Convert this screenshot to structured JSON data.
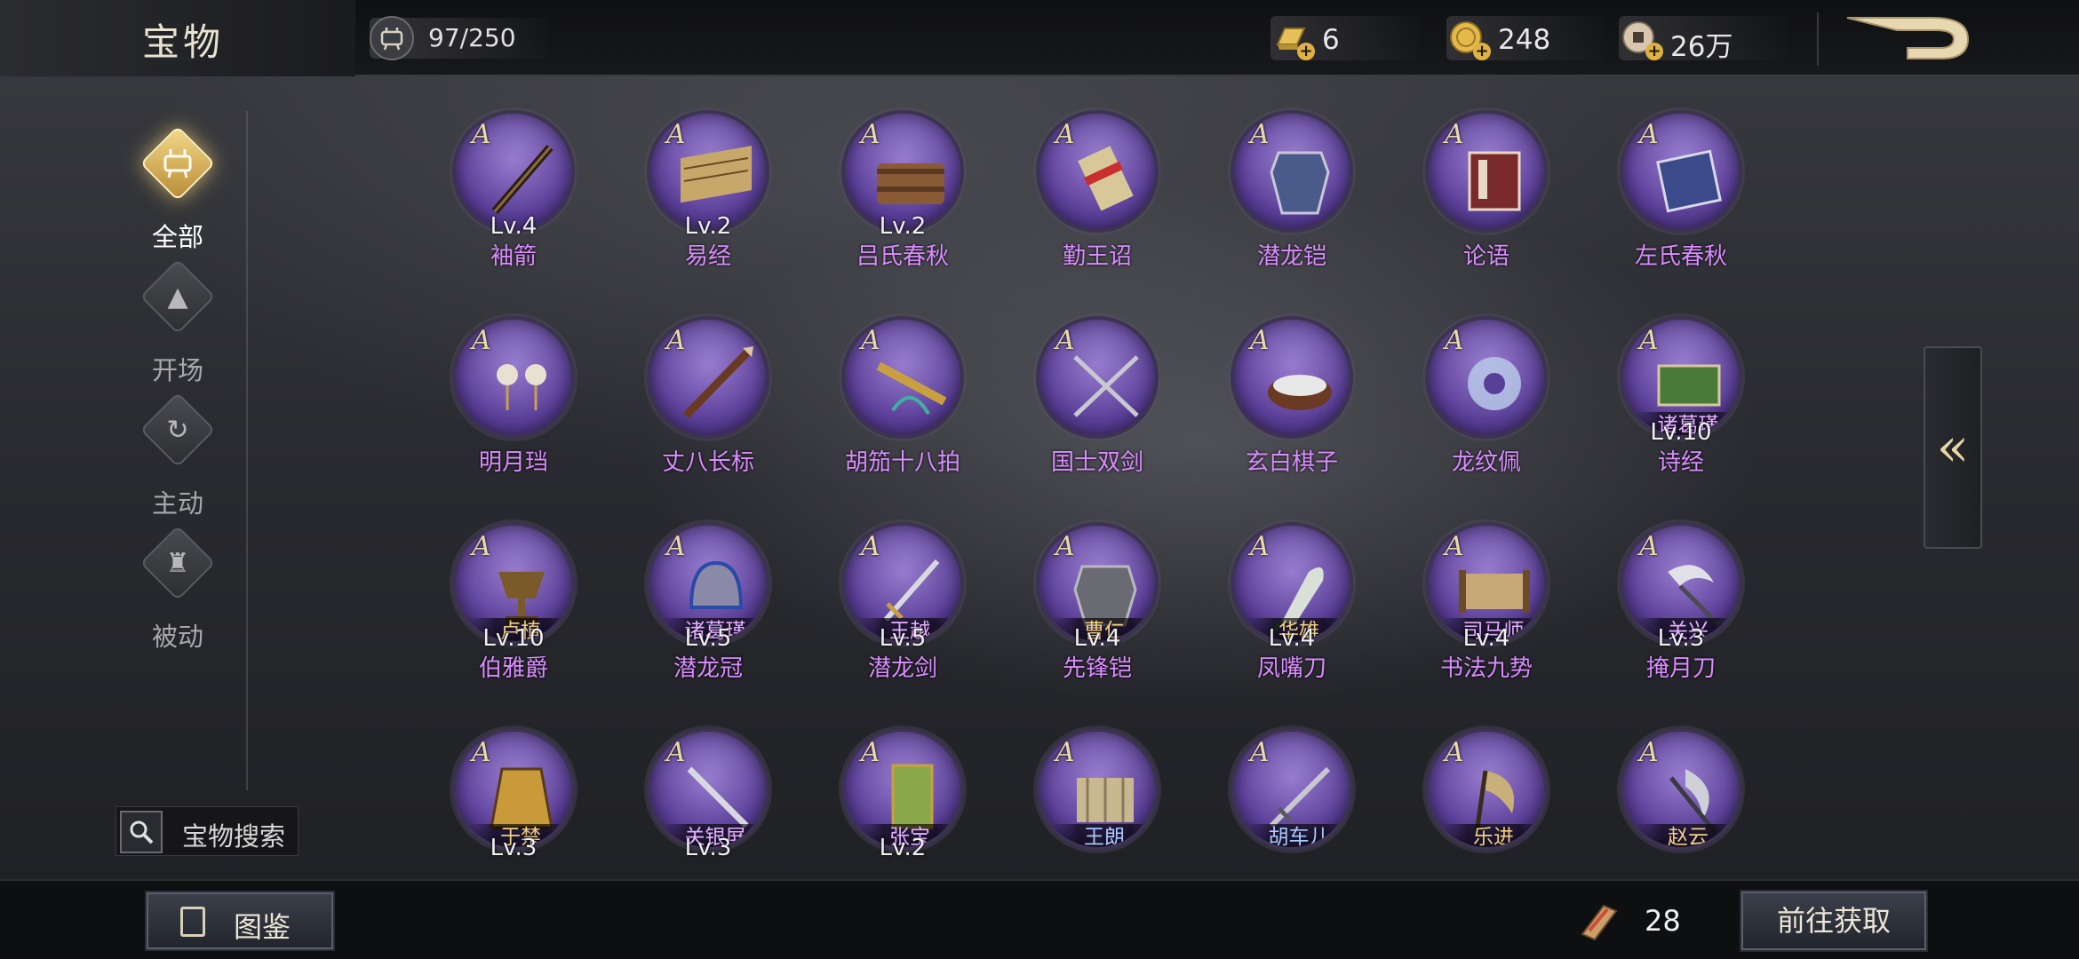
{
  "header": {
    "title": "宝物",
    "capacity": "97/250",
    "currencies": [
      {
        "name": "gold-bar-icon",
        "value": "6"
      },
      {
        "name": "coin-icon",
        "value": "248"
      },
      {
        "name": "copper-coin-icon",
        "value": "26万"
      }
    ]
  },
  "sidebar": {
    "items": [
      {
        "label": "全部",
        "icon": "cauldron-icon",
        "active": true
      },
      {
        "label": "开场",
        "icon": "pyramid-icon",
        "active": false
      },
      {
        "label": "主动",
        "icon": "swirl-icon",
        "active": false
      },
      {
        "label": "被动",
        "icon": "armor-icon",
        "active": false
      }
    ],
    "search_label": "宝物搜索"
  },
  "items": [
    {
      "grade": "A",
      "tag": "",
      "lv": "Lv.4",
      "name": "袖箭",
      "art": "staff"
    },
    {
      "grade": "A",
      "tag": "",
      "lv": "Lv.2",
      "name": "易经",
      "art": "scroll"
    },
    {
      "grade": "A",
      "tag": "",
      "lv": "Lv.2",
      "name": "吕氏春秋",
      "art": "bamboo"
    },
    {
      "grade": "A",
      "tag": "",
      "lv": "",
      "name": "勤王诏",
      "art": "redscroll"
    },
    {
      "grade": "A",
      "tag": "",
      "lv": "",
      "name": "潜龙铠",
      "art": "armor"
    },
    {
      "grade": "A",
      "tag": "",
      "lv": "",
      "name": "论语",
      "art": "book"
    },
    {
      "grade": "A",
      "tag": "",
      "lv": "",
      "name": "左氏春秋",
      "art": "bluebook"
    },
    {
      "grade": "A",
      "tag": "",
      "lv": "",
      "name": "明月珰",
      "art": "earrings"
    },
    {
      "grade": "A",
      "tag": "",
      "lv": "",
      "name": "丈八长标",
      "art": "spear"
    },
    {
      "grade": "A",
      "tag": "",
      "lv": "",
      "name": "胡笳十八拍",
      "art": "flute"
    },
    {
      "grade": "A",
      "tag": "",
      "lv": "",
      "name": "国士双剑",
      "art": "swords"
    },
    {
      "grade": "A",
      "tag": "",
      "lv": "",
      "name": "玄白棋子",
      "art": "go"
    },
    {
      "grade": "A",
      "tag": "",
      "lv": "",
      "name": "龙纹佩",
      "art": "jade"
    },
    {
      "grade": "A",
      "tag": "诸葛瑾",
      "tagc": "purple",
      "lv": "Lv.10",
      "name": "诗经",
      "art": "greenbook"
    },
    {
      "grade": "A",
      "tag": "卢植",
      "tagc": "gold",
      "lv": "Lv.10",
      "name": "伯雅爵",
      "art": "cup"
    },
    {
      "grade": "A",
      "tag": "诸葛瑾",
      "tagc": "purple",
      "lv": "Lv.5",
      "name": "潜龙冠",
      "art": "helmet"
    },
    {
      "grade": "A",
      "tag": "王越",
      "tagc": "purple",
      "lv": "Lv.5",
      "name": "潜龙剑",
      "art": "sword"
    },
    {
      "grade": "A",
      "tag": "曹仁",
      "tagc": "gold",
      "lv": "Lv.4",
      "name": "先锋铠",
      "art": "armor2"
    },
    {
      "grade": "A",
      "tag": "华雄",
      "tagc": "gold",
      "lv": "Lv.4",
      "name": "凤嘴刀",
      "art": "blade"
    },
    {
      "grade": "A",
      "tag": "司马师",
      "tagc": "purple",
      "lv": "Lv.4",
      "name": "书法九势",
      "art": "scroll2"
    },
    {
      "grade": "A",
      "tag": "关兴",
      "tagc": "purple",
      "lv": "Lv.3",
      "name": "掩月刀",
      "art": "moonblade"
    },
    {
      "grade": "A",
      "tag": "于禁",
      "tagc": "gold",
      "lv": "Lv.3",
      "name": "",
      "art": "robe"
    },
    {
      "grade": "A",
      "tag": "关银屏",
      "tagc": "purple",
      "lv": "Lv.3",
      "name": "",
      "art": "sword2"
    },
    {
      "grade": "A",
      "tag": "张宝",
      "tagc": "purple",
      "lv": "Lv.2",
      "name": "",
      "art": "banner"
    },
    {
      "grade": "A",
      "tag": "王朗",
      "tagc": "blue",
      "lv": "",
      "name": "",
      "art": "bamboo2"
    },
    {
      "grade": "A",
      "tag": "胡车儿",
      "tagc": "blue",
      "lv": "",
      "name": "",
      "art": "sword3"
    },
    {
      "grade": "A",
      "tag": "乐进",
      "tagc": "gold",
      "lv": "",
      "name": "",
      "art": "axe"
    },
    {
      "grade": "A",
      "tag": "赵云",
      "tagc": "gold",
      "lv": "",
      "name": "",
      "art": "halberd"
    }
  ],
  "footer": {
    "dex_label": "图鉴",
    "ticket_value": "28",
    "goto_label": "前往获取"
  },
  "collapse_glyph": "«"
}
